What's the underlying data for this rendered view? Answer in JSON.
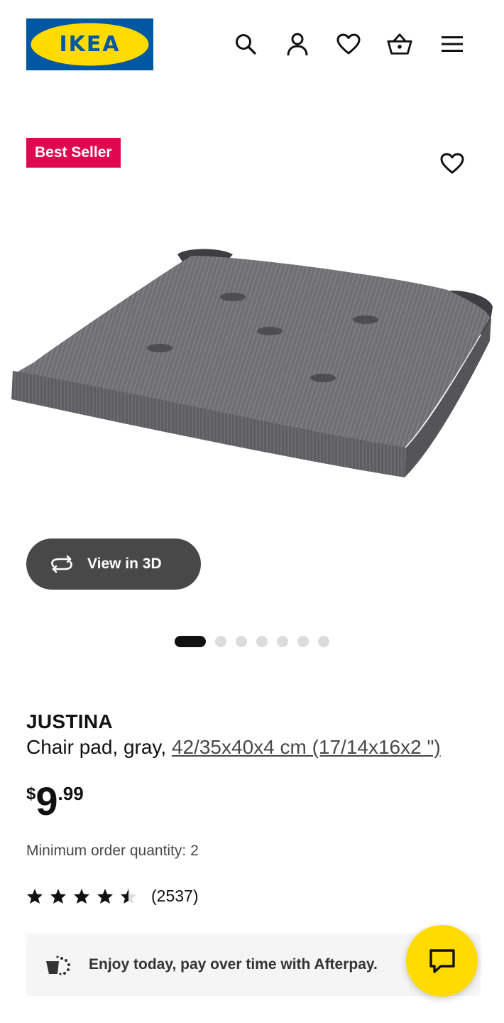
{
  "header": {
    "logo_text": "IKEA",
    "icons": [
      "search-icon",
      "user-icon",
      "heart-icon",
      "basket-icon",
      "menu-icon"
    ]
  },
  "product_media": {
    "badge": "Best Seller",
    "view_3d_label": "View in 3D",
    "carousel": {
      "total": 7,
      "active_index": 0
    }
  },
  "product": {
    "name": "JUSTINA",
    "description_prefix": "Chair pad, gray, ",
    "measurements": "42/35x40x4 cm (17/14x16x2 \")",
    "price": {
      "currency": "$",
      "integer": "9",
      "decimal": ".99"
    },
    "minimum_order": "Minimum order quantity: 2",
    "rating": {
      "value": 4.5,
      "max": 5,
      "reviews_label": "(2537)"
    }
  },
  "afterpay": {
    "text": "Enjoy today, pay over time with Afterpay."
  },
  "colors": {
    "badge": "#e00751",
    "ikea_blue": "#0058a3",
    "ikea_yellow": "#ffdb00"
  }
}
